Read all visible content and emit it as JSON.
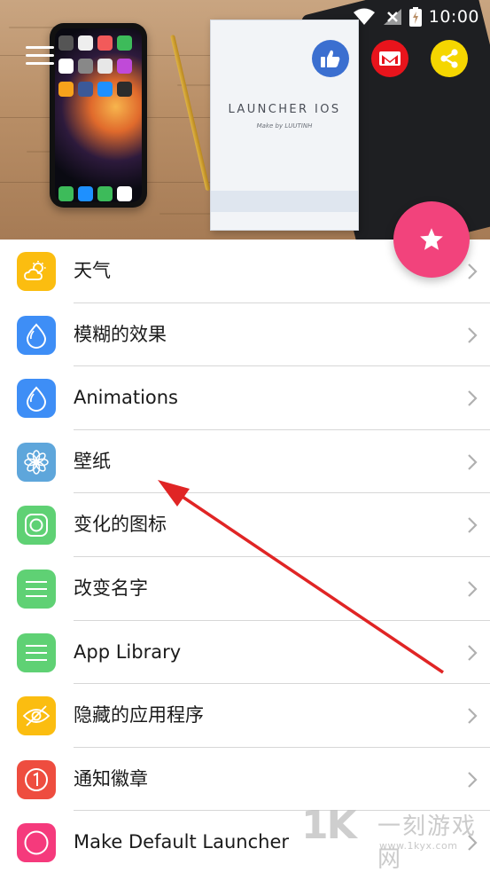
{
  "status_bar": {
    "time": "10:00",
    "icons": [
      "wifi-icon",
      "signal-icon",
      "battery-charging-icon"
    ]
  },
  "header": {
    "menu_icon": "hamburger-menu-icon",
    "notebook_title": "LAUNCHER IOS",
    "notebook_subtitle": "Make by LUUTINH",
    "action_buttons": [
      {
        "icon": "thumbs-up-icon",
        "color": "#3b6fd0"
      },
      {
        "icon": "mail-icon",
        "color": "#e8141c"
      },
      {
        "icon": "share-icon",
        "color": "#f5d600"
      }
    ],
    "fab": {
      "icon": "star-icon",
      "color": "#f2437c"
    }
  },
  "menu_items": [
    {
      "label": "天气",
      "icon": "weather-icon",
      "color": "#fbbd10"
    },
    {
      "label": "模糊的效果",
      "icon": "blur-drop-icon",
      "color": "#3e8ef6"
    },
    {
      "label": "Animations",
      "icon": "animation-drop-icon",
      "color": "#3e8ef6"
    },
    {
      "label": "壁纸",
      "icon": "wallpaper-flower-icon",
      "color": "#5ea6db"
    },
    {
      "label": "变化的图标",
      "icon": "change-icon-icon",
      "color": "#5fd174"
    },
    {
      "label": "改变名字",
      "icon": "rename-lines-icon",
      "color": "#5fd174"
    },
    {
      "label": "App Library",
      "icon": "app-library-lines-icon",
      "color": "#5fd174"
    },
    {
      "label": "隐藏的应用程序",
      "icon": "hidden-eye-icon",
      "color": "#fbbd10"
    },
    {
      "label": "通知徽章",
      "icon": "notification-badge-icon",
      "color": "#ee4d3f"
    },
    {
      "label": "Make Default Launcher",
      "icon": "default-launcher-icon",
      "color": "#f53a7c"
    }
  ],
  "watermark": {
    "logo": "1K",
    "text": "一刻游戏网",
    "url": "www.1kyx.com"
  },
  "colors": {
    "divider": "#d7d7d7",
    "chevron": "#b0b0b0",
    "annotation_arrow": "#e02525"
  }
}
